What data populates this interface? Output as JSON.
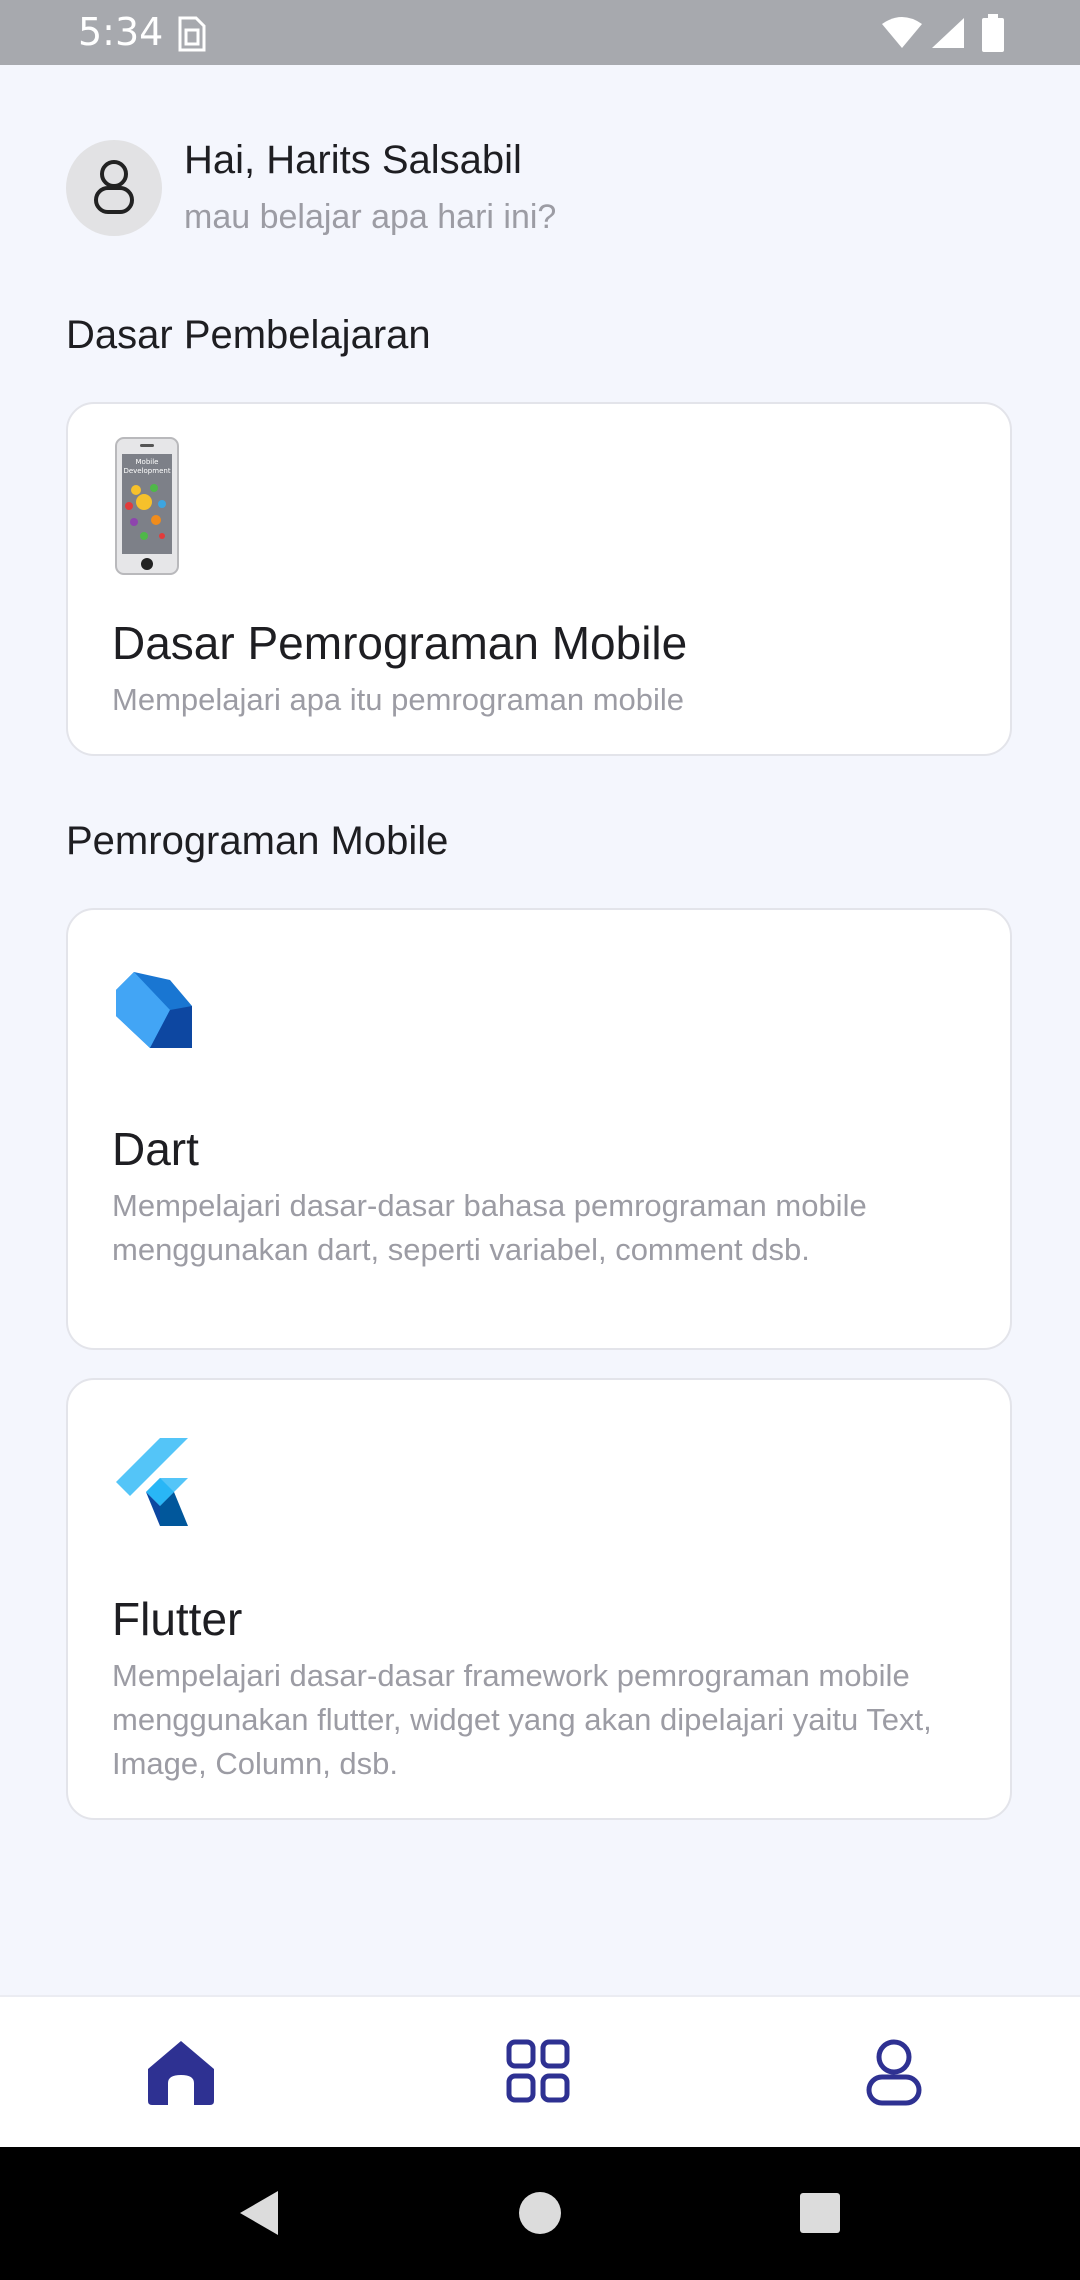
{
  "status_bar": {
    "time": "5:34",
    "icons": [
      "sim-icon",
      "wifi-icon",
      "signal-icon",
      "battery-icon"
    ]
  },
  "header": {
    "greeting": "Hai, Harits Salsabil",
    "subtitle": "mau belajar apa hari ini?",
    "avatar_icon": "user-icon"
  },
  "sections": [
    {
      "title": "Dasar Pembelajaran",
      "cards": [
        {
          "icon": "mobile-development-phone",
          "icon_caption": "Mobile Development",
          "title": "Dasar Pemrograman Mobile",
          "description": "Mempelajari apa itu pemrograman mobile"
        }
      ]
    },
    {
      "title": "Pemrograman Mobile",
      "cards": [
        {
          "icon": "dart-logo",
          "title": "Dart",
          "description": "Mempelajari dasar-dasar bahasa pemrograman mobile menggunakan dart, seperti variabel, comment dsb."
        },
        {
          "icon": "flutter-logo",
          "title": "Flutter",
          "description": "Mempelajari dasar-dasar framework pemrograman mobile menggunakan flutter, widget yang akan dipelajari yaitu Text, Image, Column, dsb."
        }
      ]
    }
  ],
  "bottom_nav": {
    "items": [
      {
        "icon": "home-icon",
        "active": true
      },
      {
        "icon": "grid-icon",
        "active": false
      },
      {
        "icon": "profile-icon",
        "active": false
      }
    ],
    "active_color": "#2E3192"
  },
  "system_nav": [
    "back-icon",
    "home-circle-icon",
    "recents-icon"
  ],
  "colors": {
    "background": "#F4F6FD",
    "status_bar": "#A7A9AE",
    "card_border": "#E3E4EA",
    "text_primary": "#1E1E22",
    "text_secondary": "#9C9CA4",
    "accent": "#2E3192"
  }
}
